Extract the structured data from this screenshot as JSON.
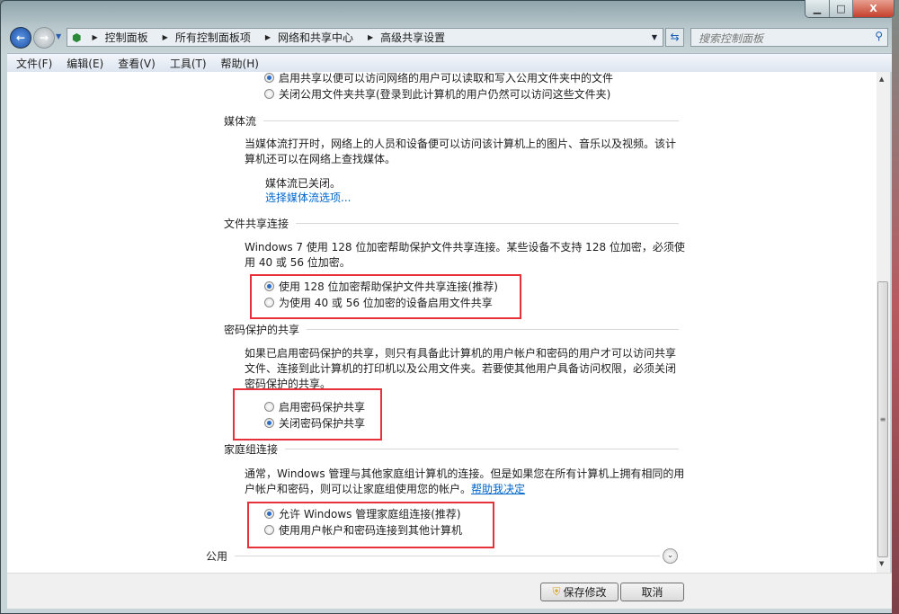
{
  "window": {
    "controls": {
      "minimize": "▁",
      "maximize": "□",
      "close": "X"
    }
  },
  "nav": {
    "breadcrumbs": [
      "控制面板",
      "所有控制面板项",
      "网络和共享中心",
      "高级共享设置"
    ],
    "search_placeholder": "搜索控制面板"
  },
  "menu": [
    "文件(F)",
    "编辑(E)",
    "查看(V)",
    "工具(T)",
    "帮助(H)"
  ],
  "public_folder": {
    "options": [
      {
        "label": "启用共享以便可以访问网络的用户可以读取和写入公用文件夹中的文件",
        "selected": true
      },
      {
        "label": "关闭公用文件夹共享(登录到此计算机的用户仍然可以访问这些文件夹)",
        "selected": false
      }
    ]
  },
  "media": {
    "title": "媒体流",
    "description": "当媒体流打开时，网络上的人员和设备便可以访问该计算机上的图片、音乐以及视频。该计算机还可以在网络上查找媒体。",
    "status": "媒体流已关闭。",
    "link": "选择媒体流选项..."
  },
  "file_sharing": {
    "title": "文件共享连接",
    "description": "Windows 7 使用 128 位加密帮助保护文件共享连接。某些设备不支持 128 位加密，必须使用 40 或 56 位加密。",
    "options": [
      {
        "label": "使用 128 位加密帮助保护文件共享连接(推荐)",
        "selected": true
      },
      {
        "label": "为使用 40 或 56 位加密的设备启用文件共享",
        "selected": false
      }
    ]
  },
  "password": {
    "title": "密码保护的共享",
    "description": "如果已启用密码保护的共享，则只有具备此计算机的用户帐户和密码的用户才可以访问共享文件、连接到此计算机的打印机以及公用文件夹。若要使其他用户具备访问权限，必须关闭密码保护的共享。",
    "options": [
      {
        "label": "启用密码保护共享",
        "selected": false
      },
      {
        "label": "关闭密码保护共享",
        "selected": true
      }
    ]
  },
  "homegroup": {
    "title": "家庭组连接",
    "description": "通常，Windows 管理与其他家庭组计算机的连接。但是如果您在所有计算机上拥有相同的用户帐户和密码，则可以让家庭组使用您的帐户。",
    "link": "帮助我决定",
    "options": [
      {
        "label": "允许 Windows 管理家庭组连接(推荐)",
        "selected": true
      },
      {
        "label": "使用用户帐户和密码连接到其他计算机",
        "selected": false
      }
    ]
  },
  "public": {
    "title": "公用"
  },
  "footer": {
    "save": "保存修改",
    "cancel": "取消"
  },
  "colors": {
    "highlight": "#e8303a",
    "link": "#0066cc"
  }
}
